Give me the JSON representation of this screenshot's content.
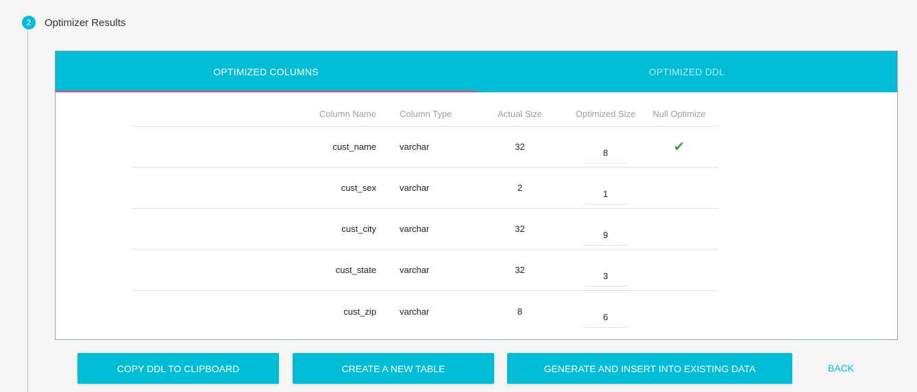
{
  "step": {
    "number": "2",
    "title": "Optimizer Results"
  },
  "tabs": [
    {
      "label": "OPTIMIZED COLUMNS",
      "active": true
    },
    {
      "label": "OPTIMIZED DDL",
      "active": false
    }
  ],
  "table": {
    "headers": {
      "name": "Column Name",
      "type": "Column Type",
      "actual": "Actual Size",
      "optimized": "Optimized Size",
      "null": "Null Optimize"
    },
    "rows": [
      {
        "name": "cust_name",
        "type": "varchar",
        "actual": "32",
        "optimized": "8",
        "null_optimize": true
      },
      {
        "name": "cust_sex",
        "type": "varchar",
        "actual": "2",
        "optimized": "1",
        "null_optimize": false
      },
      {
        "name": "cust_city",
        "type": "varchar",
        "actual": "32",
        "optimized": "9",
        "null_optimize": false
      },
      {
        "name": "cust_state",
        "type": "varchar",
        "actual": "32",
        "optimized": "3",
        "null_optimize": false
      },
      {
        "name": "cust_zip",
        "type": "varchar",
        "actual": "8",
        "optimized": "6",
        "null_optimize": false
      }
    ]
  },
  "buttons": {
    "copy": "COPY DDL TO CLIPBOARD",
    "create": "CREATE A NEW TABLE",
    "generate": "GENERATE AND INSERT INTO EXISTING DATA",
    "back": "BACK"
  },
  "colors": {
    "accent": "#00bcd4",
    "ink": "#ff4081",
    "check": "#43a047"
  },
  "icons": {
    "null_optimize": "check-icon"
  }
}
